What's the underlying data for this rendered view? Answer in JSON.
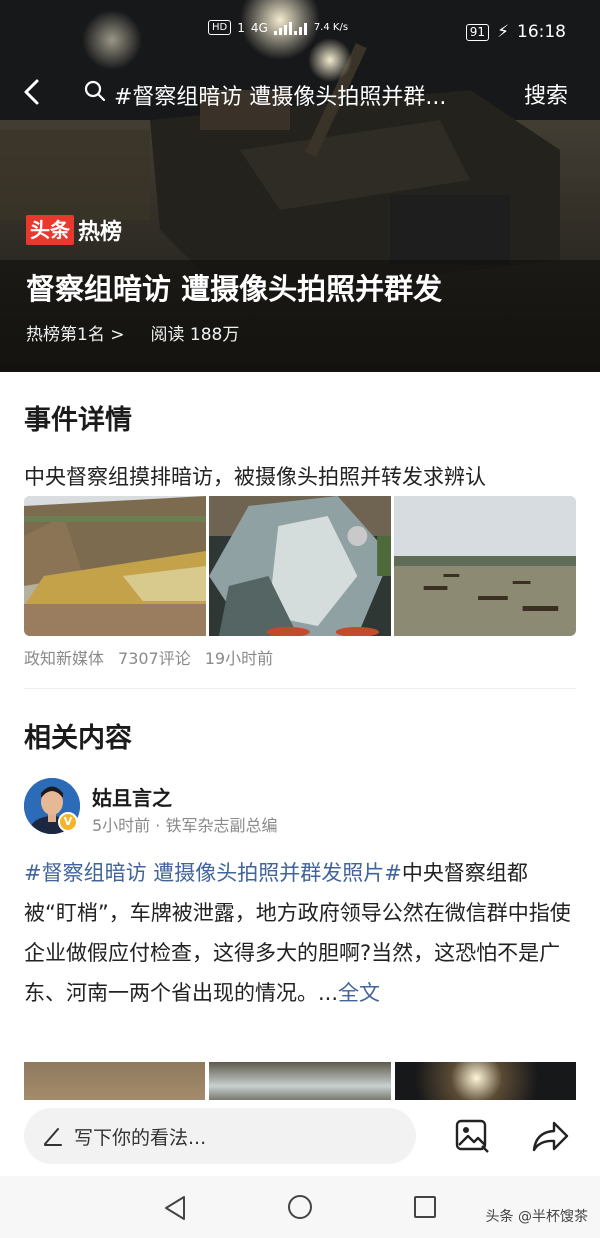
{
  "status_bar": {
    "hd": "HD",
    "sim": "1",
    "net_gen": "4G",
    "speed": "7.4 K/s",
    "battery": "91",
    "time": "16:18"
  },
  "top_bar": {
    "search_query": "#督察组暗访 遭摄像头拍照并群...",
    "search_button": "搜索"
  },
  "hero": {
    "label_red": "头条",
    "label_white": "热榜",
    "title": "督察组暗访 遭摄像头拍照并群发",
    "rank": "热榜第1名 >",
    "reads": "阅读 188万"
  },
  "event": {
    "section_title": "事件详情",
    "description": "中央督察组摸排暗访，被摄像头拍照并转发求辨认",
    "source": "政知新媒体",
    "comments": "7307评论",
    "time_ago": "19小时前"
  },
  "related": {
    "section_title": "相关内容",
    "author": "姑且言之",
    "author_meta": "5小时前 · 铁军杂志副总编",
    "verified_badge": "V",
    "hashtag": "#督察组暗访 遭摄像头拍照并群发照片#",
    "body": "中央督察组都被“盯梢”，车牌被泄露，地方政府领导公然在微信群中指使企业做假应付检查，这得多大的胆啊?当然，这恐怕不是广东、河南一两个省出现的情况。...",
    "full_text_link": "全文"
  },
  "comment_bar": {
    "placeholder": "写下你的看法..."
  },
  "watermark": "头条 @半杯馊茶",
  "colors": {
    "accent_red": "#e8392f",
    "link_blue": "#40649b",
    "meta_gray": "#8a8a8a"
  },
  "icons": [
    "back-icon",
    "search-icon",
    "pencil-icon",
    "image-icon",
    "share-icon",
    "nav-back-icon",
    "nav-home-icon",
    "nav-recent-icon"
  ]
}
